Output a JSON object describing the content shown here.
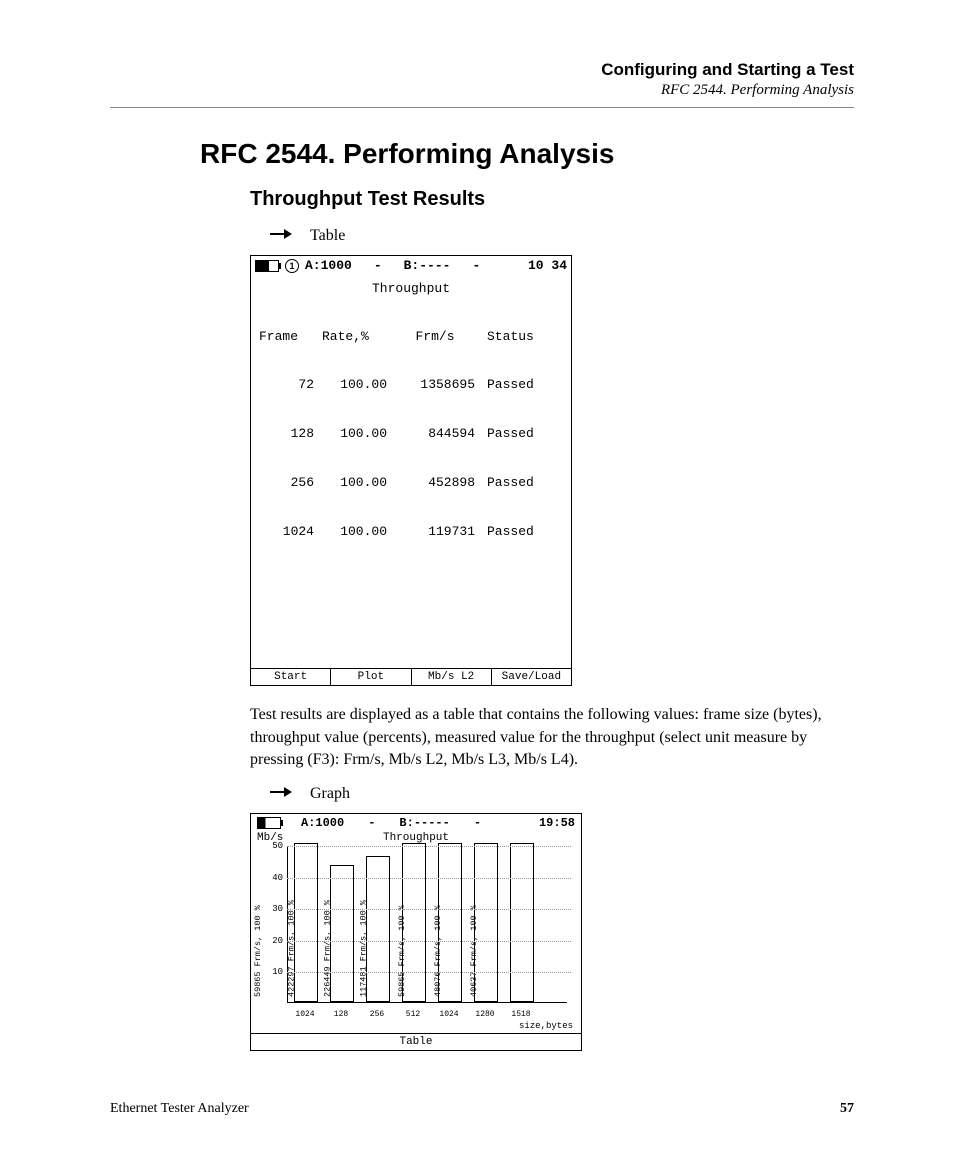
{
  "header": {
    "title": "Configuring and Starting a Test",
    "subtitle": "RFC 2544. Performing Analysis"
  },
  "h1": "RFC 2544. Performing Analysis",
  "h2": "Throughput Test Results",
  "bullets": {
    "table": "Table",
    "graph": "Graph"
  },
  "paragraph": "Test results are displayed as a table that contains the following values: frame size (bytes), throughput value (percents), measured value for the throughput (select unit measure by pressing (F3): Frm/s, Mb/s L2, Mb/s L3, Mb/s L4).",
  "screen1": {
    "statusbar": {
      "a": "A:1000",
      "dash1": "-",
      "b": "B:----",
      "dash2": "-",
      "time": "10 34",
      "circ": "1"
    },
    "title": "Throughput",
    "columns": [
      "Frame",
      "Rate,%",
      "Frm/s",
      "Status"
    ],
    "rows": [
      {
        "frame": "72",
        "rate": "100.00",
        "frms": "1358695",
        "status": "Passed"
      },
      {
        "frame": "128",
        "rate": "100.00",
        "frms": "844594",
        "status": "Passed"
      },
      {
        "frame": "256",
        "rate": "100.00",
        "frms": "452898",
        "status": "Passed"
      },
      {
        "frame": "1024",
        "rate": "100.00",
        "frms": "119731",
        "status": "Passed"
      }
    ],
    "fkeys": [
      "Start",
      "Plot",
      "Mb/s L2",
      "Save/Load"
    ]
  },
  "screen2": {
    "statusbar": {
      "a": "A:1000",
      "dash1": "-",
      "b": "B:-----",
      "dash2": "-",
      "time": "19:58"
    },
    "ylabel": "Mb/s",
    "title": "Throughput",
    "xlabel_unit": "size,bytes",
    "fkey": "Table"
  },
  "chart_data": {
    "type": "bar",
    "ylabel": "Mb/s",
    "xlabel": "size,bytes",
    "title": "Throughput",
    "ylim": [
      0,
      50
    ],
    "yticks": [
      10,
      20,
      30,
      40,
      50
    ],
    "categories": [
      "1024",
      "128",
      "256",
      "512",
      "1024",
      "1280",
      "1518"
    ],
    "values": [
      50,
      43,
      46,
      50,
      50,
      50,
      50
    ],
    "bar_labels": [
      "59865  Frm/s, 100 %",
      "422297 Frm/s, 100 %",
      "226449 Frm/s, 100 %",
      "117481 Frm/s, 100 %",
      "59865  Frm/s, 100 %",
      "48076  Frm/s, 100 %",
      "40637  Frm/s, 100 %"
    ]
  },
  "footer": {
    "product": "Ethernet Tester Analyzer",
    "page": "57"
  }
}
